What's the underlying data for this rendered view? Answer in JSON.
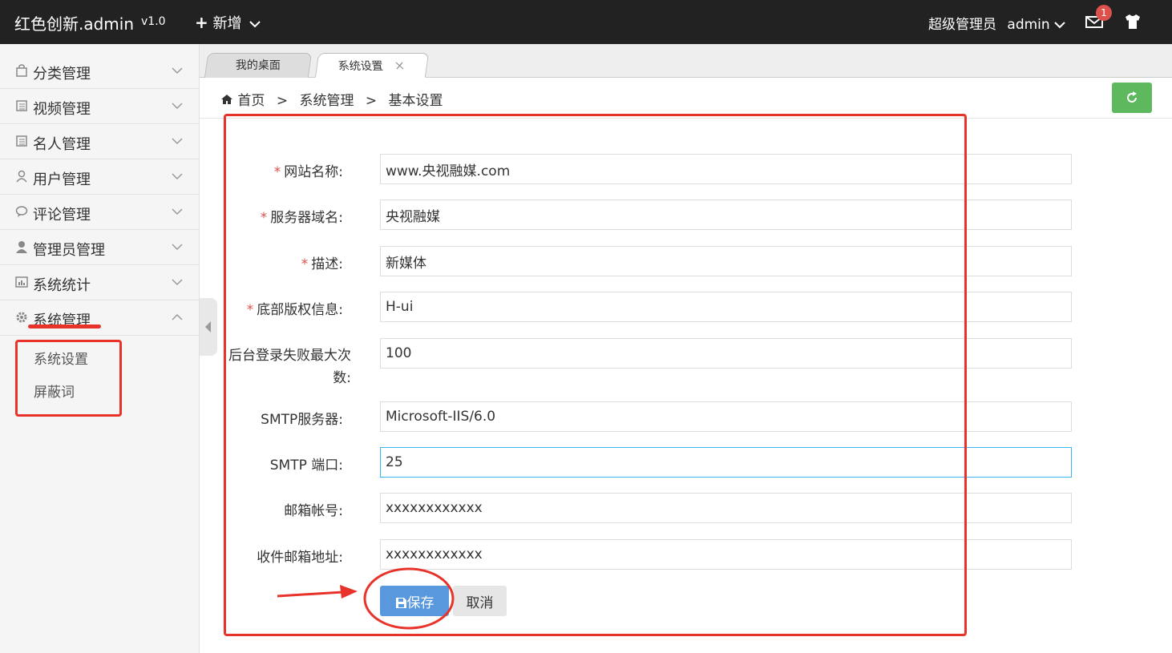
{
  "topbar": {
    "brand": "红色创新.admin",
    "version": "v1.0",
    "add_label": "新增",
    "user_role": "超级管理员",
    "username": "admin",
    "message_count": "1",
    "colors": {
      "bg": "#222222",
      "badge": "#dd514c"
    }
  },
  "sidebar": {
    "items": [
      {
        "label": "分类管理",
        "icon": "bag-icon"
      },
      {
        "label": "视频管理",
        "icon": "list-icon"
      },
      {
        "label": "名人管理",
        "icon": "list-icon"
      },
      {
        "label": "用户管理",
        "icon": "user-icon"
      },
      {
        "label": "评论管理",
        "icon": "comment-icon"
      },
      {
        "label": "管理员管理",
        "icon": "admin-icon"
      },
      {
        "label": "系统统计",
        "icon": "stats-icon"
      },
      {
        "label": "系统管理",
        "icon": "gear-icon"
      }
    ],
    "sub_items": [
      "系统设置",
      "屏蔽词"
    ]
  },
  "tabs": [
    "我的桌面",
    "系统设置"
  ],
  "breadcrumb": [
    "首页",
    "系统管理",
    "基本设置"
  ],
  "breadcrumb_sep": ">",
  "form": {
    "fields": [
      {
        "label": "网站名称:",
        "required": true,
        "value": "www.央视融媒.com"
      },
      {
        "label": "服务器域名:",
        "required": true,
        "value": "央视融媒"
      },
      {
        "label": "描述:",
        "required": true,
        "value": "新媒体"
      },
      {
        "label": "底部版权信息:",
        "required": true,
        "value": "H-ui"
      },
      {
        "label": "后台登录失败最大次数:",
        "required": false,
        "value": "100"
      },
      {
        "label": "SMTP服务器:",
        "required": false,
        "value": "Microsoft-IIS/6.0"
      },
      {
        "label": "SMTP 端口:",
        "required": false,
        "value": "25"
      },
      {
        "label": "邮箱帐号:",
        "required": false,
        "value": "xxxxxxxxxxxx"
      },
      {
        "label": "收件邮箱地址:",
        "required": false,
        "value": "xxxxxxxxxxxx"
      }
    ],
    "required_mark": "*",
    "save_label": "保存",
    "cancel_label": "取消",
    "colors": {
      "save": "#5a98de",
      "cancel": "#e6e6e6",
      "required": "#dd514c",
      "focus": "#3bb4f2"
    }
  },
  "annotation_color": "#e8332a"
}
